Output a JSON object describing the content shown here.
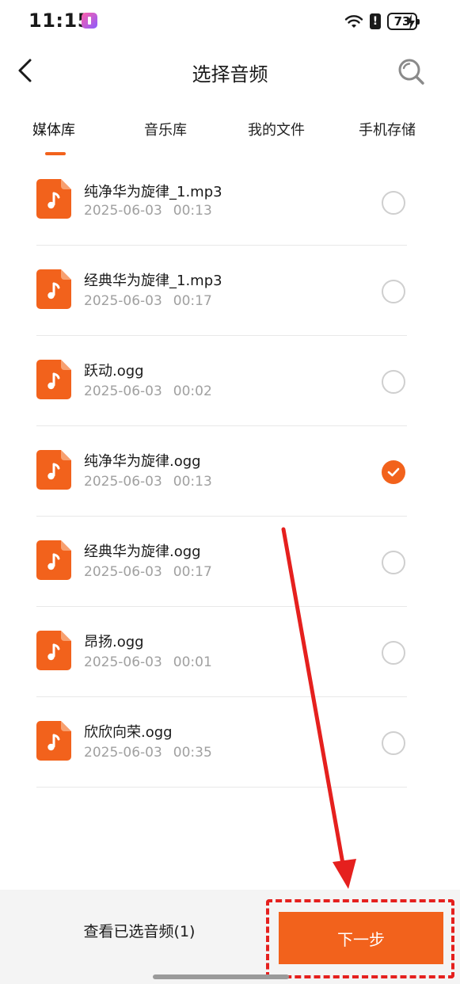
{
  "status_bar": {
    "time": "11:15",
    "battery": "73"
  },
  "header": {
    "title": "选择音频"
  },
  "tabs": [
    {
      "label": "媒体库",
      "active": true
    },
    {
      "label": "音乐库",
      "active": false
    },
    {
      "label": "我的文件",
      "active": false
    },
    {
      "label": "手机存储",
      "active": false
    }
  ],
  "files": [
    {
      "name": "纯净华为旋律_1.mp3",
      "date": "2025-06-03",
      "duration": "00:13",
      "selected": false
    },
    {
      "name": "经典华为旋律_1.mp3",
      "date": "2025-06-03",
      "duration": "00:17",
      "selected": false
    },
    {
      "name": "跃动.ogg",
      "date": "2025-06-03",
      "duration": "00:02",
      "selected": false
    },
    {
      "name": "纯净华为旋律.ogg",
      "date": "2025-06-03",
      "duration": "00:13",
      "selected": true
    },
    {
      "name": "经典华为旋律.ogg",
      "date": "2025-06-03",
      "duration": "00:17",
      "selected": false
    },
    {
      "name": "昂扬.ogg",
      "date": "2025-06-03",
      "duration": "00:01",
      "selected": false
    },
    {
      "name": "欣欣向荣.ogg",
      "date": "2025-06-03",
      "duration": "00:35",
      "selected": false
    }
  ],
  "bottom": {
    "selected_label": "查看已选音频(1)",
    "next_label": "下一步"
  },
  "colors": {
    "accent": "#f2621c",
    "annotation": "#e5201e"
  },
  "icons": {
    "back": "chevron-left-icon",
    "search": "search-icon",
    "file": "music-file-icon",
    "check": "check-icon"
  }
}
